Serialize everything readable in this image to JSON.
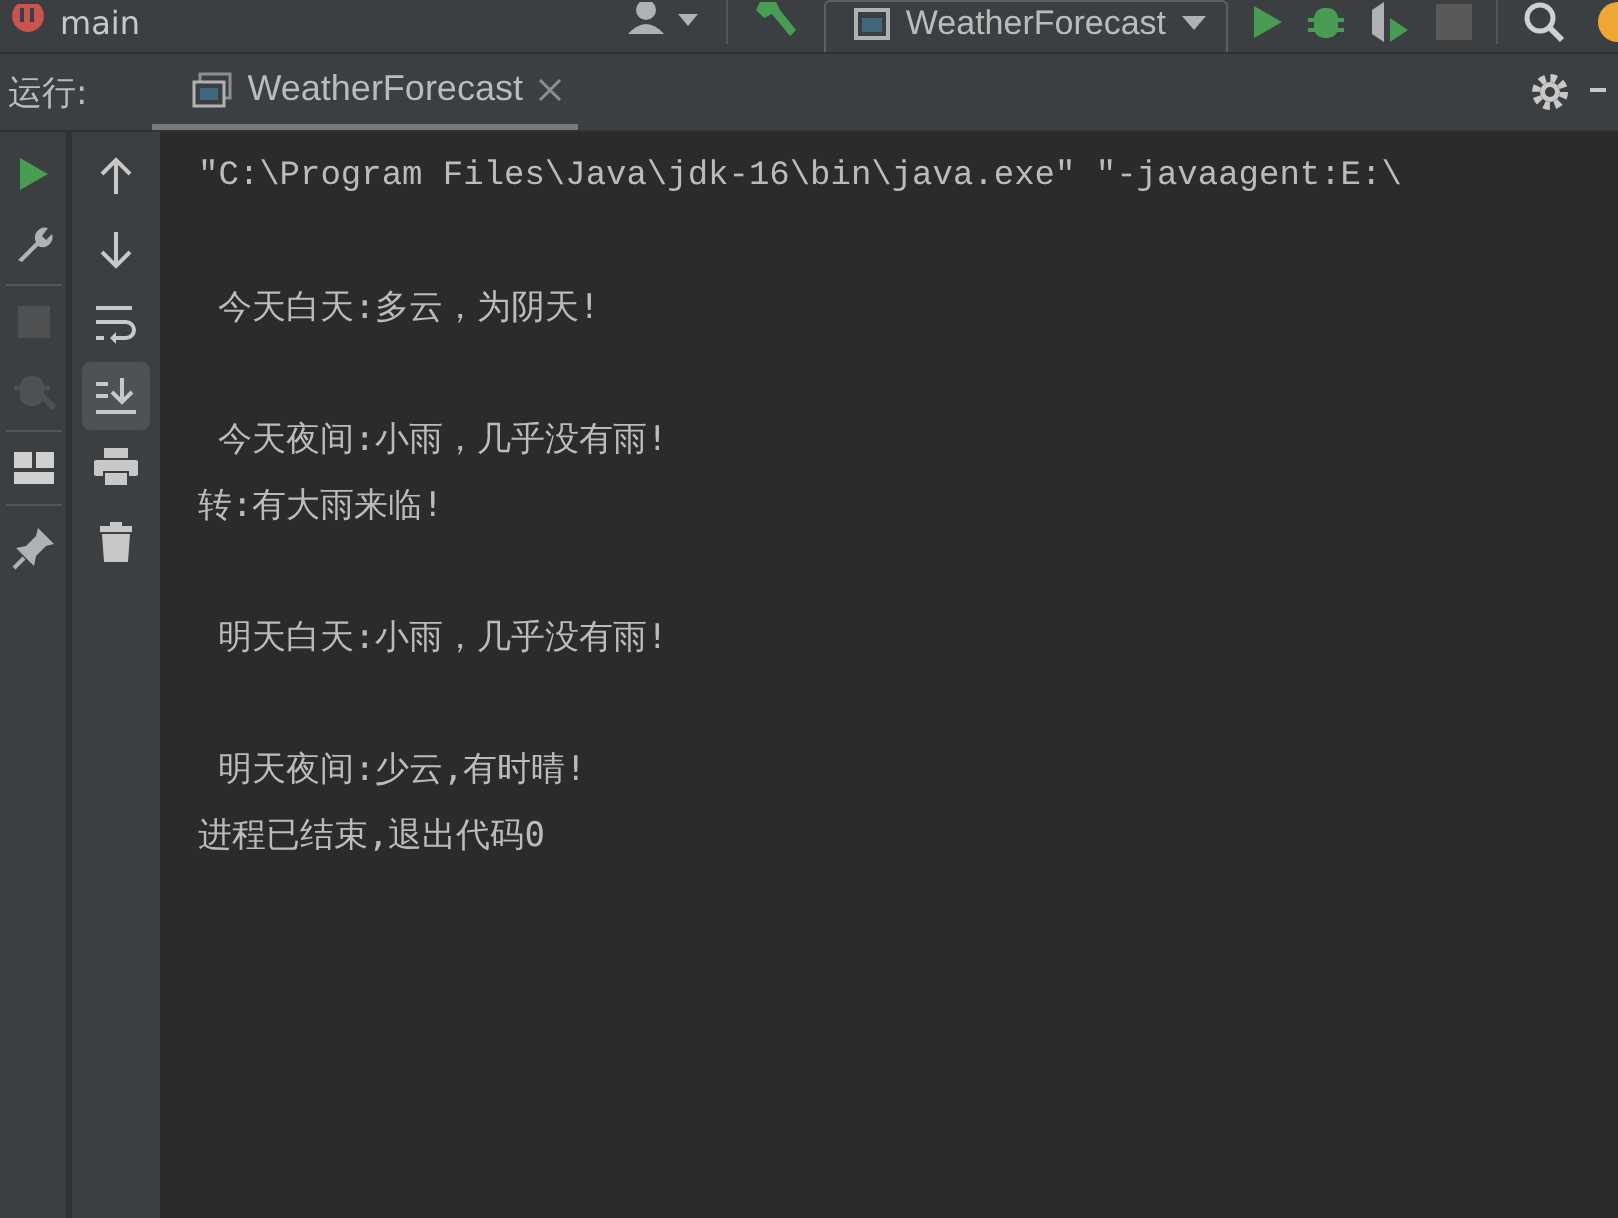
{
  "toolbar": {
    "branch": "main",
    "run_config": "WeatherForecast"
  },
  "run_panel": {
    "label": "运行:",
    "tabs": [
      {
        "label": "WeatherForecast",
        "selected": true
      }
    ]
  },
  "console": {
    "blocks": [
      {
        "lines": [
          {
            "text": "\"C:\\Program Files\\Java\\jdk-16\\bin\\java.exe\" \"-javaagent:E:\\",
            "kind": "command"
          }
        ]
      },
      {
        "lines": [
          {
            "text": " 今天白天:多云，为阴天!",
            "kind": "output"
          }
        ]
      },
      {
        "lines": [
          {
            "text": " 今天夜间:小雨，几乎没有雨!",
            "kind": "output"
          },
          {
            "text": "转:有大雨来临!",
            "kind": "output"
          }
        ]
      },
      {
        "lines": [
          {
            "text": " 明天白天:小雨，几乎没有雨!",
            "kind": "output"
          }
        ]
      },
      {
        "lines": [
          {
            "text": " 明天夜间:少云,有时晴!",
            "kind": "output"
          },
          {
            "text": "进程已结束,退出代码0",
            "kind": "output"
          }
        ]
      }
    ]
  }
}
